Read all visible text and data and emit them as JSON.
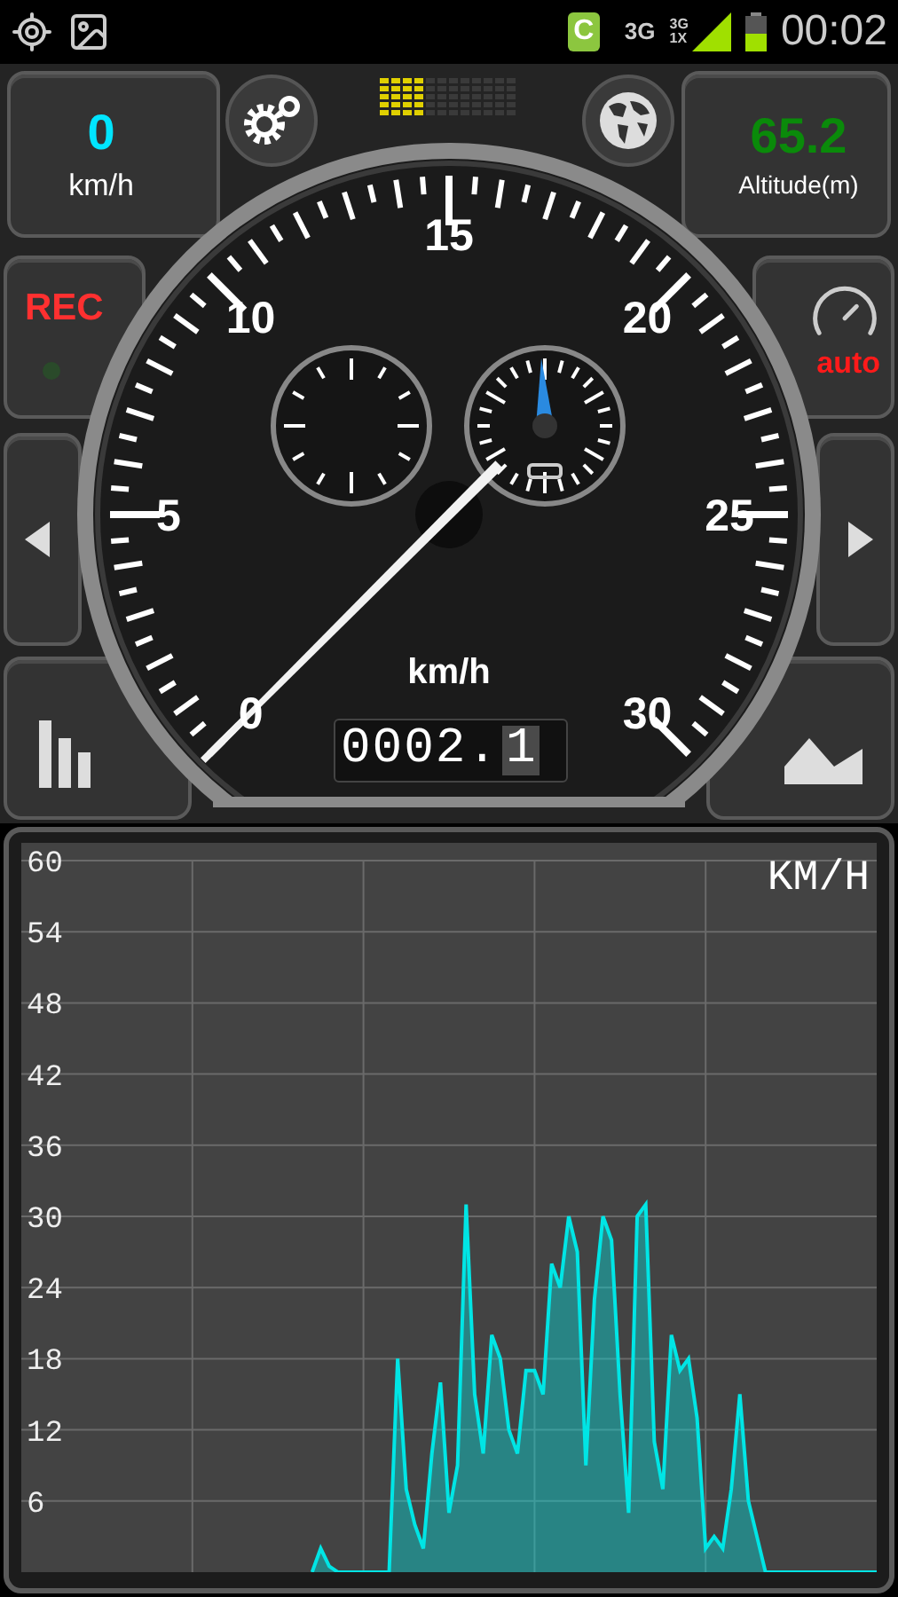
{
  "status_bar": {
    "app_badge": "C",
    "network": "3G",
    "signal_labels": [
      "3G",
      "1X"
    ],
    "time": "00:02"
  },
  "speed_panel": {
    "value": "0",
    "unit": "km/h"
  },
  "gps_meter": {
    "level": 0.33
  },
  "altitude_panel": {
    "value": "65.2",
    "label": "Altitude(m)"
  },
  "rec_button": {
    "label": "REC",
    "recording": false
  },
  "auto_button": {
    "label": "auto"
  },
  "dial": {
    "labels": [
      "0",
      "5",
      "10",
      "15",
      "20",
      "25",
      "30"
    ],
    "unit": "km/h",
    "level": 0
  },
  "odometer": {
    "integer": "0002.",
    "fraction": "1"
  },
  "chart": {
    "chart_data": {
      "type": "area",
      "ylabel": "KM/H",
      "grid": true,
      "ylim": [
        0,
        60
      ],
      "yticks": [
        6,
        12,
        18,
        24,
        30,
        36,
        42,
        48,
        54,
        60
      ],
      "categories": [
        null,
        null,
        null,
        null,
        null,
        null,
        null,
        null,
        null,
        null,
        null,
        null,
        null,
        null,
        null,
        null,
        null,
        null,
        null,
        null,
        null,
        null,
        null,
        null,
        null,
        null,
        null,
        null,
        null,
        null,
        null,
        null,
        null,
        null,
        null,
        null,
        null,
        null,
        null,
        null,
        null,
        null,
        null,
        null,
        null,
        null,
        null,
        null,
        null,
        null,
        null,
        null,
        null,
        null,
        null,
        null,
        null,
        null,
        null,
        null,
        null,
        null,
        null,
        null,
        null,
        null,
        null,
        null,
        null,
        null,
        null,
        null,
        null,
        null,
        null,
        null,
        null,
        null,
        null,
        null,
        null,
        null,
        null,
        null,
        null,
        null,
        null,
        null,
        null,
        null,
        null,
        null,
        null,
        null,
        null,
        null,
        null,
        null,
        null,
        null,
        null
      ],
      "series": [
        {
          "color": "#00e5e5",
          "values": [
            null,
            null,
            null,
            null,
            null,
            null,
            null,
            null,
            null,
            null,
            null,
            null,
            null,
            null,
            null,
            null,
            null,
            null,
            null,
            null,
            null,
            null,
            null,
            null,
            null,
            null,
            null,
            null,
            null,
            null,
            null,
            null,
            null,
            null,
            0,
            2,
            0.5,
            0,
            0,
            0,
            0,
            0,
            0,
            0,
            18,
            7,
            4,
            2,
            10,
            16,
            5,
            9,
            31,
            15,
            10,
            20,
            18,
            12,
            10,
            17,
            17,
            15,
            26,
            24,
            30,
            27,
            9,
            23,
            30,
            28,
            15,
            5,
            30,
            31,
            11,
            7,
            20,
            17,
            18,
            13,
            2,
            3,
            2,
            7,
            15,
            6,
            3,
            0,
            0,
            0,
            0,
            0,
            0,
            0,
            0,
            0,
            0,
            0,
            0,
            0,
            0
          ]
        }
      ]
    }
  }
}
